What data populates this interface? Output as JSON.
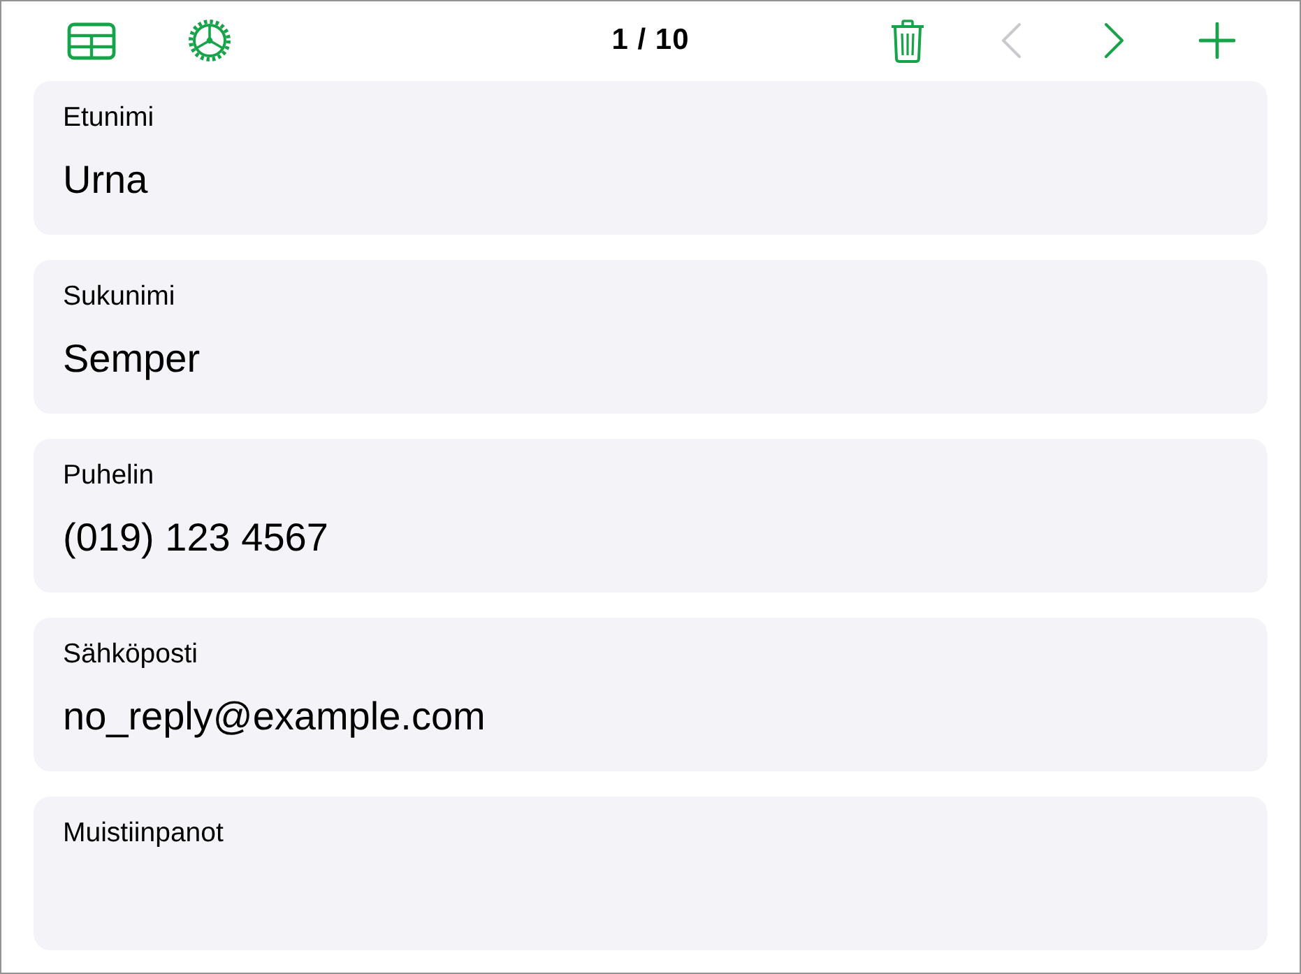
{
  "toolbar": {
    "left": [
      {
        "kind": "table",
        "disabled": false
      },
      {
        "kind": "settings",
        "disabled": false
      }
    ],
    "counter": "1 / 10",
    "right": [
      {
        "kind": "delete",
        "disabled": false
      },
      {
        "kind": "previous",
        "disabled": true
      },
      {
        "kind": "next",
        "disabled": false
      },
      {
        "kind": "add",
        "disabled": false
      }
    ]
  },
  "fields": [
    {
      "label": "Etunimi",
      "value": "Urna"
    },
    {
      "label": "Sukunimi",
      "value": "Semper"
    },
    {
      "label": "Puhelin",
      "value": "(019) 123 4567"
    },
    {
      "label": "Sähköposti",
      "value": "no_reply@example.com"
    },
    {
      "label": "Muistiinpanot"
    }
  ]
}
